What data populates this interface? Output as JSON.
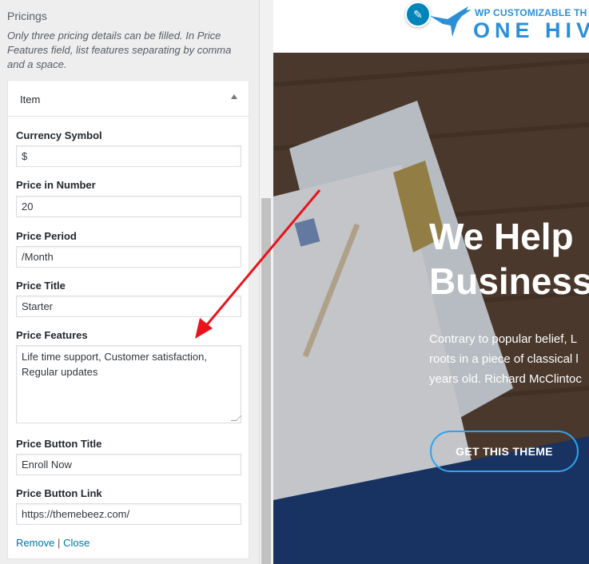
{
  "section": {
    "title": "Pricings",
    "description": "Only three pricing details can be filled. In Price Features field, list features separating by comma and a space."
  },
  "item": {
    "header": "Item",
    "fields": {
      "currency_symbol": {
        "label": "Currency Symbol",
        "value": "$"
      },
      "price_number": {
        "label": "Price in Number",
        "value": "20"
      },
      "price_period": {
        "label": "Price Period",
        "value": "/Month"
      },
      "price_title": {
        "label": "Price Title",
        "value": "Starter"
      },
      "price_features": {
        "label": "Price Features",
        "value": "Life time support, Customer satisfaction, Regular updates"
      },
      "button_title": {
        "label": "Price Button Title",
        "value": "Enroll Now"
      },
      "button_link": {
        "label": "Price Button Link",
        "value": "https://themebeez.com/"
      }
    },
    "remove_label": "Remove",
    "separator": "|",
    "close_label": "Close"
  },
  "preview": {
    "logo_small": "WP CUSTOMIZABLE TH",
    "logo_big": "ONE HIV",
    "hero_title_line1": "We Help",
    "hero_title_line2": "Business",
    "hero_text_line1": "Contrary to popular belief, L",
    "hero_text_line2": "roots in a piece of classical l",
    "hero_text_line3": "years old. Richard McClintoc",
    "cta_label": "GET THIS THEME"
  },
  "colors": {
    "link": "#0073aa",
    "accent": "#2ea3f2",
    "annotation_arrow": "#e8141b"
  },
  "icons": [
    "chevron-up-icon",
    "edit-pencil-icon",
    "hummingbird-logo-icon",
    "resize-grip-icon",
    "annotation-arrow-icon"
  ]
}
